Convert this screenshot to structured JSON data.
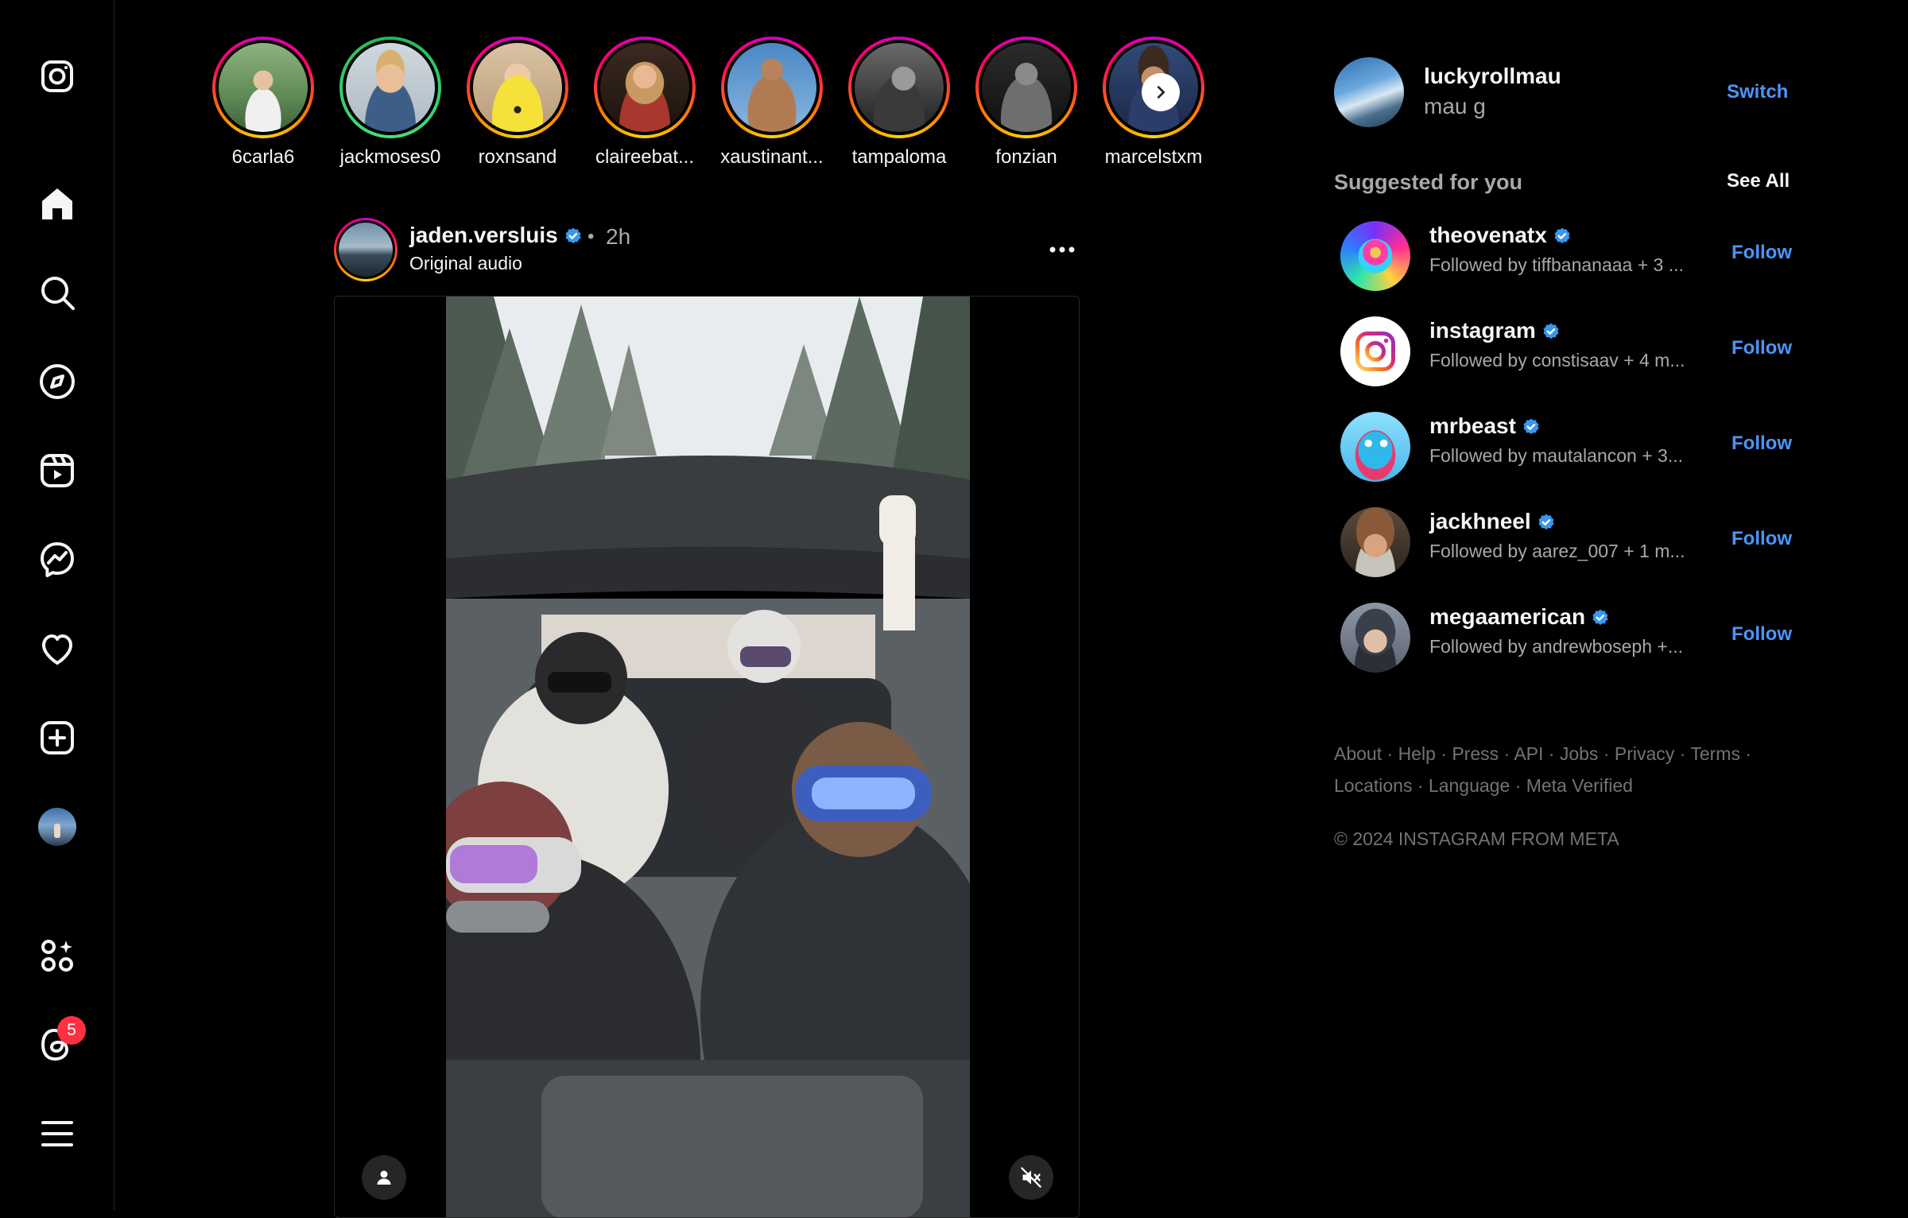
{
  "nav": {
    "items": [
      {
        "name": "instagram-logo-icon"
      },
      {
        "name": "home-icon"
      },
      {
        "name": "search-icon"
      },
      {
        "name": "explore-icon"
      },
      {
        "name": "reels-icon"
      },
      {
        "name": "messenger-icon"
      },
      {
        "name": "heart-icon"
      },
      {
        "name": "create-icon"
      },
      {
        "name": "profile-avatar"
      },
      {
        "name": "meta-ai-icon"
      },
      {
        "name": "threads-icon"
      },
      {
        "name": "menu-icon"
      }
    ],
    "threads_badge": "5"
  },
  "stories": [
    {
      "username": "6carla6"
    },
    {
      "username": "jackmoses0"
    },
    {
      "username": "roxnsand"
    },
    {
      "username": "claireebat..."
    },
    {
      "username": "xaustinant..."
    },
    {
      "username": "tampaloma"
    },
    {
      "username": "fonzian"
    },
    {
      "username": "marcelstxm"
    }
  ],
  "post": {
    "username": "jaden.versluis",
    "separator": "•",
    "time": "2h",
    "audio": "Original audio"
  },
  "current_user": {
    "username": "luckyrollmau",
    "name": "mau g",
    "switch_label": "Switch"
  },
  "suggestions": {
    "title": "Suggested for you",
    "see_all": "See All",
    "items": [
      {
        "username": "theovenatx",
        "followed_by": "Followed by tiffbananaaa + 3 ...",
        "action": "Follow"
      },
      {
        "username": "instagram",
        "followed_by": "Followed by constisaav + 4 m...",
        "action": "Follow"
      },
      {
        "username": "mrbeast",
        "followed_by": "Followed by mautalancon + 3...",
        "action": "Follow"
      },
      {
        "username": "jackhneel",
        "followed_by": "Followed by aarez_007 + 1 m...",
        "action": "Follow"
      },
      {
        "username": "megaamerican",
        "followed_by": "Followed by andrewboseph +...",
        "action": "Follow"
      }
    ]
  },
  "footer": {
    "links": [
      "About",
      "Help",
      "Press",
      "API",
      "Jobs",
      "Privacy",
      "Terms",
      "Locations",
      "Language",
      "Meta Verified"
    ],
    "separator": "·",
    "copyright": "© 2024 INSTAGRAM FROM META"
  },
  "colors": {
    "background": "#000000",
    "link_blue": "#4a96ff",
    "muted": "#a8a8a8",
    "badge_red": "#ff3040",
    "verified_blue": "#3897f0"
  }
}
